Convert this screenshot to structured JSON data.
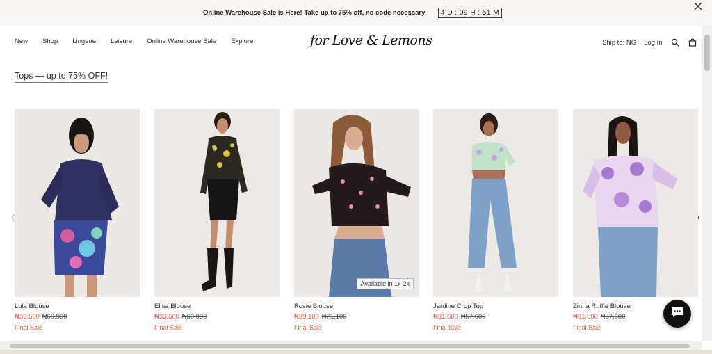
{
  "promo": {
    "text": "Online Warehouse Sale is Here! Take up to 75% off, no code necessary",
    "countdown": "4 D : 09 H : 51 M",
    "close_icon": "close-icon"
  },
  "header": {
    "nav": [
      "New",
      "Shop",
      "Lingerie",
      "Leisure",
      "Online Warehouse Sale",
      "Explore"
    ],
    "logo": "for Love & Lemons",
    "ship_to": "Ship to: NG",
    "login": "Log In",
    "search_icon": "search-icon",
    "bag_icon": "bag-icon"
  },
  "section": {
    "title": "Tops — up to 75% OFF!"
  },
  "products": [
    {
      "name": "Lula Blouse",
      "sale_price": "₦33,500",
      "orig_price": "₦60,900",
      "tag": "Final Sale",
      "avail": ""
    },
    {
      "name": "Elisa Blouse",
      "sale_price": "₦33,500",
      "orig_price": "₦60,900",
      "tag": "Final Sale",
      "avail": ""
    },
    {
      "name": "Rosie Blouse",
      "sale_price": "₦39,100",
      "orig_price": "₦71,100",
      "tag": "Final Sale",
      "avail": "Available in 1x-2x"
    },
    {
      "name": "Jardine Crop Top",
      "sale_price": "₦31,600",
      "orig_price": "₦57,600",
      "tag": "Final Sale",
      "avail": ""
    },
    {
      "name": "Zinna Ruffle Blouse",
      "sale_price": "₦31,600",
      "orig_price": "₦57,600",
      "tag": "Final Sale",
      "avail": ""
    }
  ],
  "colors": {
    "sale": "#e3573f",
    "promo_bg": "#faf6f2"
  }
}
